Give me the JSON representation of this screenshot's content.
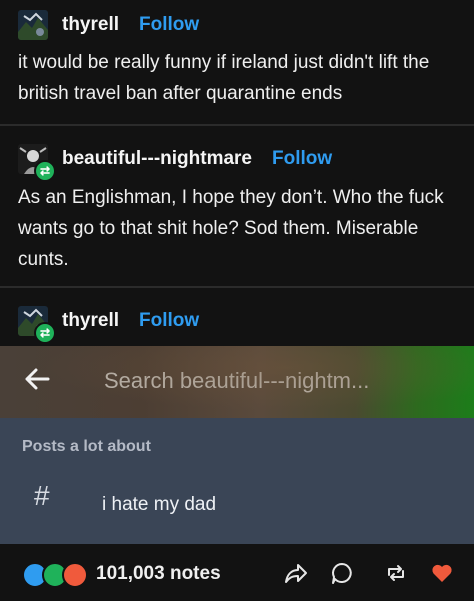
{
  "posts": [
    {
      "username": "thyrell",
      "follow_label": "Follow",
      "text": "it would be really funny if ireland just didn't lift the british travel ban after quarantine ends"
    },
    {
      "username": "beautiful---nightmare",
      "follow_label": "Follow",
      "text": "As an Englishman, I hope they don’t. Who the fuck wants go to that shit hole? Sod them. Miserable cunts."
    },
    {
      "username": "thyrell",
      "follow_label": "Follow"
    }
  ],
  "embedded": {
    "search_placeholder": "Search beautiful---nightm...",
    "section_label": "Posts a lot about",
    "tag_symbol": "#",
    "tag_text": "i hate my dad"
  },
  "footer": {
    "notes_count": "101,003 notes"
  },
  "colors": {
    "accent_blue": "#2f9cf0",
    "reblog_green": "#1fb25a",
    "like_red": "#f05a3c"
  }
}
